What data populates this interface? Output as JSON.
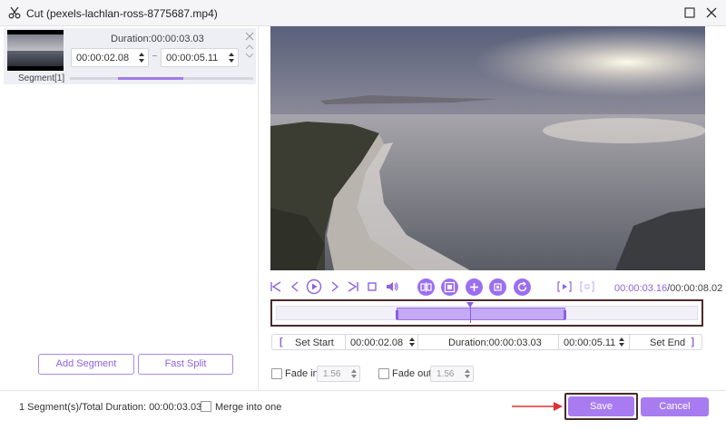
{
  "window": {
    "title": "Cut (pexels-lachlan-ross-8775687.mp4)"
  },
  "segment": {
    "duration": "Duration:00:00:03.03",
    "start": "00:00:02.08",
    "end": "00:00:05.11",
    "label": "Segment[1]",
    "progress_fraction": 0.36
  },
  "left_buttons": {
    "add": "Add Segment",
    "split": "Fast Split"
  },
  "player": {
    "current_time": "00:00:03.16",
    "total_time": "/00:00:08.02"
  },
  "range": {
    "set_start": "Set Start",
    "start": "00:00:02.08",
    "duration": "Duration:00:00:03.03",
    "end": "00:00:05.11",
    "set_end": "Set End"
  },
  "fade": {
    "in_label": "Fade in",
    "in_value": "1.56",
    "out_label": "Fade out",
    "out_value": "1.56"
  },
  "footer": {
    "stats": "1 Segment(s)/Total Duration: 00:00:03.03",
    "merge_label": "Merge into one",
    "save": "Save",
    "cancel": "Cancel"
  },
  "colors": {
    "accent": "#9b6ff0",
    "accent_text": "#8c63dd",
    "annotation_frame": "#4a2a2a",
    "arrow": "#e03030"
  }
}
